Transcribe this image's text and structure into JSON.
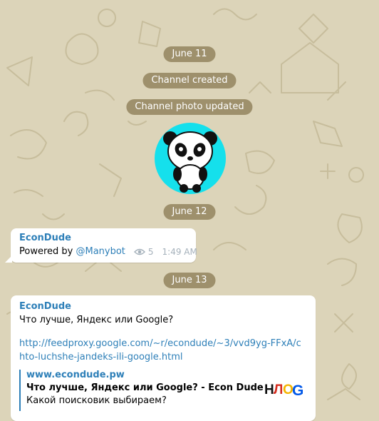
{
  "dates": {
    "first": "June 11",
    "second": "June 12",
    "third": "June 13"
  },
  "service": {
    "created": "Channel created",
    "photo_updated": "Channel photo updated"
  },
  "messages": [
    {
      "author": "EconDude",
      "text_prefix": "Powered by ",
      "mention": "@Manybot",
      "views": "5",
      "time": "1:49 AM"
    },
    {
      "author": "EconDude",
      "text": "Что лучше, Яндекс или Google?",
      "url": "http://feedproxy.google.com/~r/econdude/~3/vvd9yg-FFxA/chto-luchshe-jandeks-ili-google.html",
      "preview": {
        "site": "www.econdude.pw",
        "title": "Что лучше, Яндекс или Google? - Econ Dude",
        "description": "Какой поисковик выбираем?"
      }
    }
  ],
  "colors": {
    "background": "#dcd4b9",
    "accent": "#2d7fb8",
    "pill": "#87764e",
    "avatar_bg": "#15e0ec"
  },
  "icons": {
    "views": "eye-icon",
    "avatar": "panda-avatar-icon",
    "preview_thumb": "yandex-google-logo-icon"
  }
}
